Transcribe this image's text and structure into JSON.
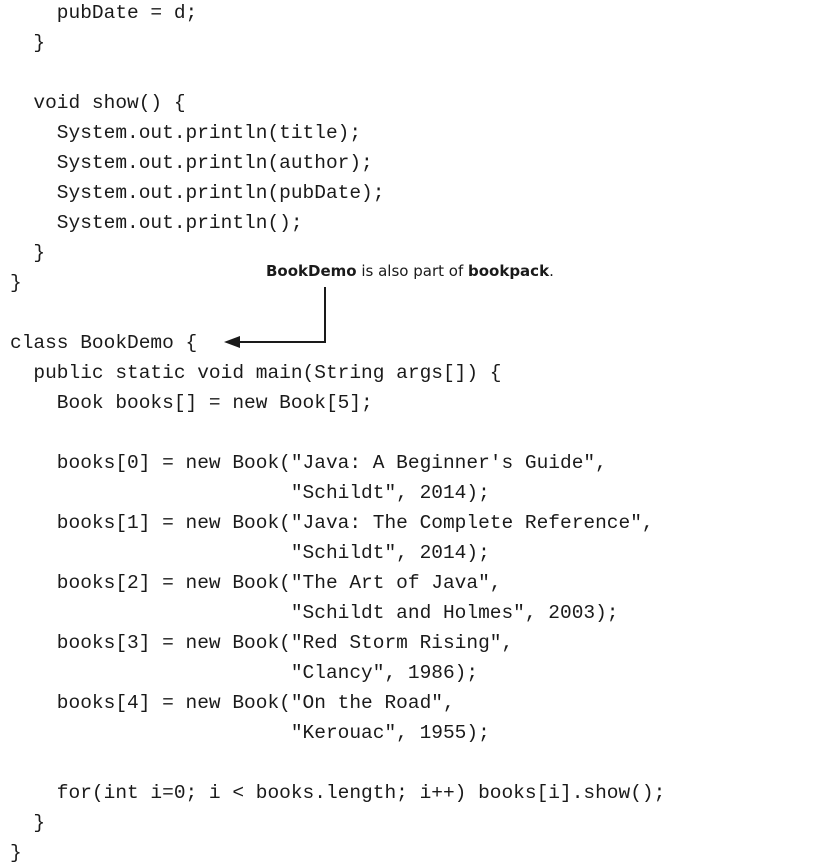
{
  "code_lines": [
    "    pubDate = d;",
    "  }",
    "",
    "  void show() {",
    "    System.out.println(title);",
    "    System.out.println(author);",
    "    System.out.println(pubDate);",
    "    System.out.println();",
    "  }",
    "}",
    "",
    "class BookDemo {",
    "  public static void main(String args[]) {",
    "    Book books[] = new Book[5];",
    "",
    "    books[0] = new Book(\"Java: A Beginner's Guide\",",
    "                        \"Schildt\", 2014);",
    "    books[1] = new Book(\"Java: The Complete Reference\",",
    "                        \"Schildt\", 2014);",
    "    books[2] = new Book(\"The Art of Java\",",
    "                        \"Schildt and Holmes\", 2003);",
    "    books[3] = new Book(\"Red Storm Rising\",",
    "                        \"Clancy\", 1986);",
    "    books[4] = new Book(\"On the Road\",",
    "                        \"Kerouac\", 1955);",
    "",
    "    for(int i=0; i < books.length; i++) books[i].show();",
    "  }",
    "}"
  ],
  "annotation": {
    "class_name": "BookDemo",
    "middle_text": " is also part of ",
    "package_name": "bookpack",
    "end_text": "."
  }
}
